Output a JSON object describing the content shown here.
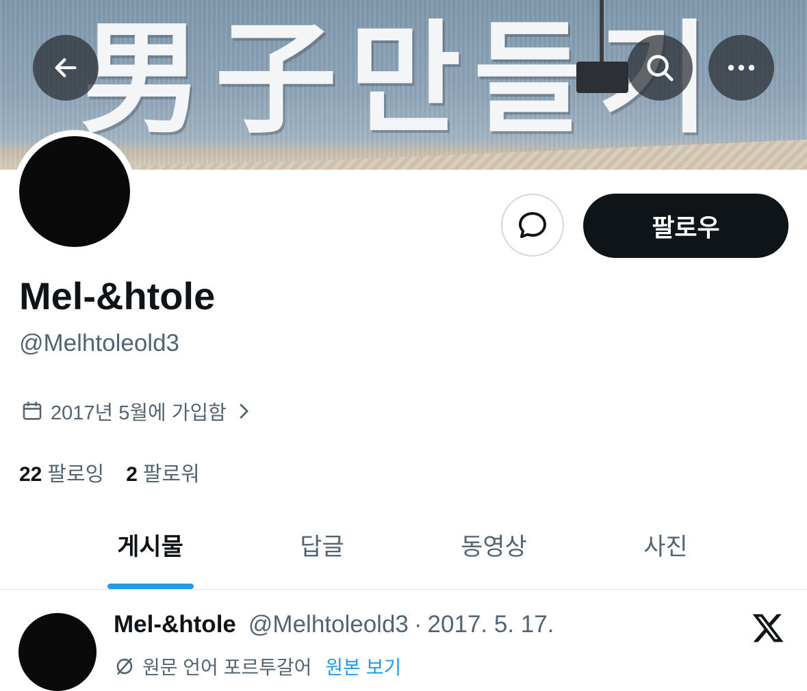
{
  "banner": {
    "sign_text": "男子만들기"
  },
  "nav": {
    "back_icon": "arrow-left-icon",
    "search_icon": "search-icon",
    "more_icon": "ellipsis-icon"
  },
  "profile": {
    "display_name": "Mel-&htole",
    "handle": "@Melhtoleold3",
    "joined": "2017년 5월에 가입함",
    "following_count": "22",
    "following_label": "팔로잉",
    "followers_count": "2",
    "followers_label": "팔로워"
  },
  "actions": {
    "message_icon": "message-bubble-icon",
    "follow_label": "팔로우"
  },
  "tabs": [
    {
      "label": "게시물",
      "active": true
    },
    {
      "label": "답글",
      "active": false
    },
    {
      "label": "동영상",
      "active": false
    },
    {
      "label": "사진",
      "active": false
    }
  ],
  "post": {
    "author_name": "Mel-&htole",
    "author_handle": "@Melhtoleold3",
    "separator": "·",
    "date": "2017. 5. 17.",
    "translation_note": "원문 언어 포르투갈어",
    "show_original": "원본 보기"
  },
  "colors": {
    "accent": "#1d9bf0",
    "text_primary": "#0f1419",
    "text_secondary": "#536471",
    "follow_button_bg": "#0f1419"
  }
}
